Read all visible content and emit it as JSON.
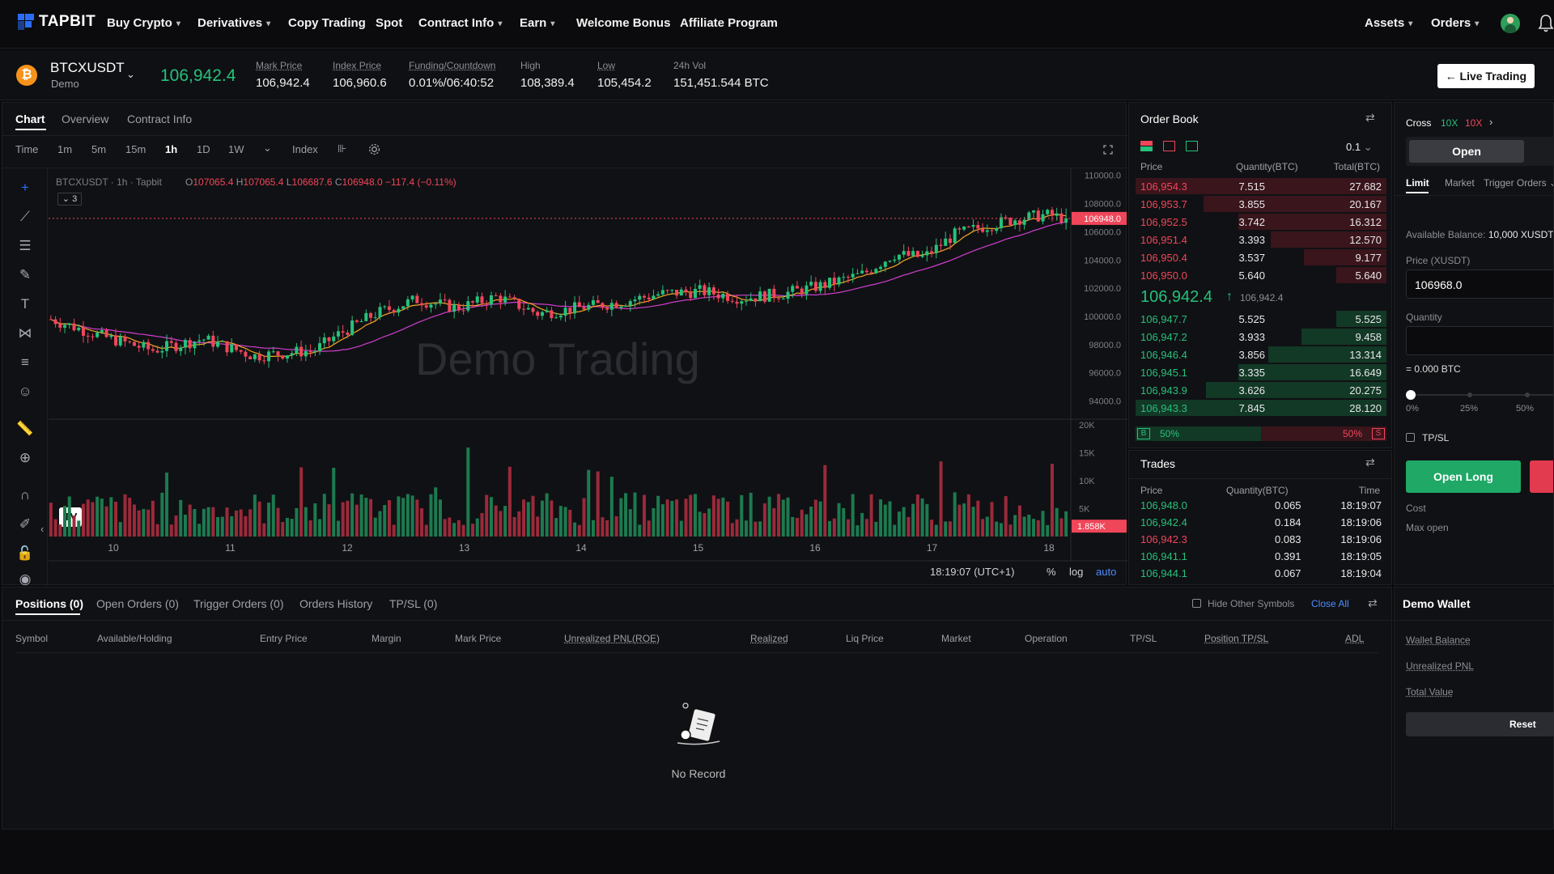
{
  "brand": {
    "name": "TAPBIT"
  },
  "nav": {
    "items": [
      {
        "label": "Buy Crypto",
        "has_dropdown": true
      },
      {
        "label": "Derivatives",
        "has_dropdown": true
      },
      {
        "label": "Copy Trading",
        "has_dropdown": false
      },
      {
        "label": "Spot",
        "has_dropdown": false
      },
      {
        "label": "Contract Info",
        "has_dropdown": true
      },
      {
        "label": "Earn",
        "has_dropdown": true
      },
      {
        "label": "Welcome Bonus",
        "has_dropdown": false
      },
      {
        "label": "Affiliate Program",
        "has_dropdown": false
      }
    ],
    "right": {
      "assets": "Assets",
      "orders": "Orders"
    }
  },
  "ticker": {
    "symbol": "BTCXUSDT",
    "mode": "Demo",
    "last_price": "106,942.4",
    "stats": [
      {
        "label": "Mark Price",
        "value": "106,942.4"
      },
      {
        "label": "Index Price",
        "value": "106,960.6"
      },
      {
        "label": "Funding/Countdown",
        "value": "0.01%/06:40:52"
      },
      {
        "label": "High",
        "value": "108,389.4"
      },
      {
        "label": "Low",
        "value": "105,454.2"
      },
      {
        "label": "24h Vol",
        "value": "151,451.544 BTC"
      }
    ],
    "live_button": "Live Trading"
  },
  "chart_panel": {
    "tabs": [
      "Chart",
      "Overview",
      "Contract Info"
    ],
    "intervals": [
      "Time",
      "1m",
      "5m",
      "15m",
      "1h",
      "1D",
      "1W"
    ],
    "active_interval": "1h",
    "index_label": "Index",
    "legend": {
      "symbol": "BTCXUSDT · 1h · Tapbit",
      "o": "107065.4",
      "h": "107065.4",
      "l": "106687.6",
      "c": "106948.0",
      "change": "−117.4 (−0.11%)",
      "indicators": "3"
    },
    "watermark": "Demo Trading",
    "price_ticks": [
      "110000.0",
      "108000.0",
      "106000.0",
      "104000.0",
      "102000.0",
      "100000.0",
      "98000.0",
      "96000.0",
      "94000.0"
    ],
    "current_price_tag": "106948.0",
    "volume_ticks": [
      "20K",
      "15K",
      "10K",
      "5K"
    ],
    "volume_tag": "1.858K",
    "date_ticks": [
      "10",
      "11",
      "12",
      "13",
      "14",
      "15",
      "16",
      "17",
      "18"
    ],
    "time": "18:19:07 (UTC+1)",
    "scale_opts": [
      "%",
      "log",
      "auto"
    ]
  },
  "chart_data": {
    "type": "candlestick",
    "title": "BTCXUSDT · 1h · Tapbit",
    "x_ticks": [
      "10",
      "11",
      "12",
      "13",
      "14",
      "15",
      "16",
      "17",
      "18"
    ],
    "ylim": [
      93000,
      110500
    ],
    "price_path": [
      [
        0,
        99800
      ],
      [
        0.05,
        98600
      ],
      [
        0.1,
        97600
      ],
      [
        0.15,
        98400
      ],
      [
        0.2,
        97200
      ],
      [
        0.26,
        97600
      ],
      [
        0.28,
        98600
      ],
      [
        0.32,
        100200
      ],
      [
        0.36,
        101200
      ],
      [
        0.4,
        100600
      ],
      [
        0.44,
        101400
      ],
      [
        0.48,
        100200
      ],
      [
        0.52,
        100600
      ],
      [
        0.56,
        101000
      ],
      [
        0.6,
        101600
      ],
      [
        0.64,
        101800
      ],
      [
        0.68,
        101300
      ],
      [
        0.72,
        101600
      ],
      [
        0.76,
        102200
      ],
      [
        0.8,
        103000
      ],
      [
        0.83,
        104400
      ],
      [
        0.86,
        104200
      ],
      [
        0.89,
        105800
      ],
      [
        0.92,
        106400
      ],
      [
        0.95,
        106900
      ],
      [
        0.98,
        107200
      ],
      [
        1,
        106948
      ]
    ],
    "last_close": 106948.0,
    "volume_ylim": [
      0,
      21000
    ]
  },
  "orderbook": {
    "title": "Order Book",
    "precision": "0.1",
    "headers": [
      "Price",
      "Quantity(BTC)",
      "Total(BTC)"
    ],
    "asks": [
      {
        "price": "106,954.3",
        "qty": "7.515",
        "total": "27.682",
        "depth": 1.0
      },
      {
        "price": "106,953.7",
        "qty": "3.855",
        "total": "20.167",
        "depth": 0.73
      },
      {
        "price": "106,952.5",
        "qty": "3.742",
        "total": "16.312",
        "depth": 0.59
      },
      {
        "price": "106,951.4",
        "qty": "3.393",
        "total": "12.570",
        "depth": 0.46
      },
      {
        "price": "106,950.4",
        "qty": "3.537",
        "total": "9.177",
        "depth": 0.33
      },
      {
        "price": "106,950.0",
        "qty": "5.640",
        "total": "5.640",
        "depth": 0.2
      }
    ],
    "mid_price": "106,942.4",
    "mid_mark": "106,942.4",
    "bids": [
      {
        "price": "106,947.7",
        "qty": "5.525",
        "total": "5.525",
        "depth": 0.2
      },
      {
        "price": "106,947.2",
        "qty": "3.933",
        "total": "9.458",
        "depth": 0.34
      },
      {
        "price": "106,946.4",
        "qty": "3.856",
        "total": "13.314",
        "depth": 0.47
      },
      {
        "price": "106,945.1",
        "qty": "3.335",
        "total": "16.649",
        "depth": 0.59
      },
      {
        "price": "106,943.9",
        "qty": "3.626",
        "total": "20.275",
        "depth": 0.72
      },
      {
        "price": "106,943.3",
        "qty": "7.845",
        "total": "28.120",
        "depth": 1.0
      }
    ],
    "buy_pct": "50%",
    "sell_pct": "50%",
    "buy_tag": "B",
    "sell_tag": "S"
  },
  "trades": {
    "title": "Trades",
    "headers": [
      "Price",
      "Quantity(BTC)",
      "Time"
    ],
    "rows": [
      {
        "price": "106,948.0",
        "qty": "0.065",
        "time": "18:19:07",
        "side": "buy"
      },
      {
        "price": "106,942.4",
        "qty": "0.184",
        "time": "18:19:06",
        "side": "buy"
      },
      {
        "price": "106,942.3",
        "qty": "0.083",
        "time": "18:19:06",
        "side": "sell"
      },
      {
        "price": "106,941.1",
        "qty": "0.391",
        "time": "18:19:05",
        "side": "buy"
      },
      {
        "price": "106,944.1",
        "qty": "0.067",
        "time": "18:19:04",
        "side": "buy"
      }
    ]
  },
  "order_form": {
    "margin_mode": "Cross",
    "lev_long": "10X",
    "lev_short": "10X",
    "open_tab": "Open",
    "order_types": [
      "Limit",
      "Market",
      "Trigger Orders"
    ],
    "available_label": "Available Balance:",
    "available_value": "10,000 XUSDT",
    "price_label": "Price (XUSDT)",
    "price_value": "106968.0",
    "qty_label": "Quantity",
    "qty_equiv": "= 0.000 BTC",
    "slider_marks": [
      "0%",
      "25%",
      "50%"
    ],
    "tpsl": "TP/SL",
    "open_long": "Open Long",
    "cost_label": "Cost",
    "max_open_label": "Max open"
  },
  "positions": {
    "tabs": [
      "Positions (0)",
      "Open Orders (0)",
      "Trigger Orders (0)",
      "Orders History",
      "TP/SL (0)"
    ],
    "hide_other": "Hide Other Symbols",
    "close_all": "Close All",
    "columns": [
      "Symbol",
      "Available/Holding",
      "Entry Price",
      "Margin",
      "Mark Price",
      "Unrealized PNL(ROE)",
      "Realized",
      "Liq Price",
      "Market",
      "Operation",
      "TP/SL",
      "Position TP/SL",
      "ADL"
    ],
    "empty": "No Record"
  },
  "wallet": {
    "title": "Demo Wallet",
    "rows": [
      "Wallet Balance",
      "Unrealized PNL",
      "Total Value"
    ],
    "reset": "Reset"
  },
  "colors": {
    "up": "#26c17b",
    "down": "#f0465a",
    "brand": "#2b6cf6",
    "ma1": "#f5a623",
    "ma2": "#d13ed1"
  }
}
